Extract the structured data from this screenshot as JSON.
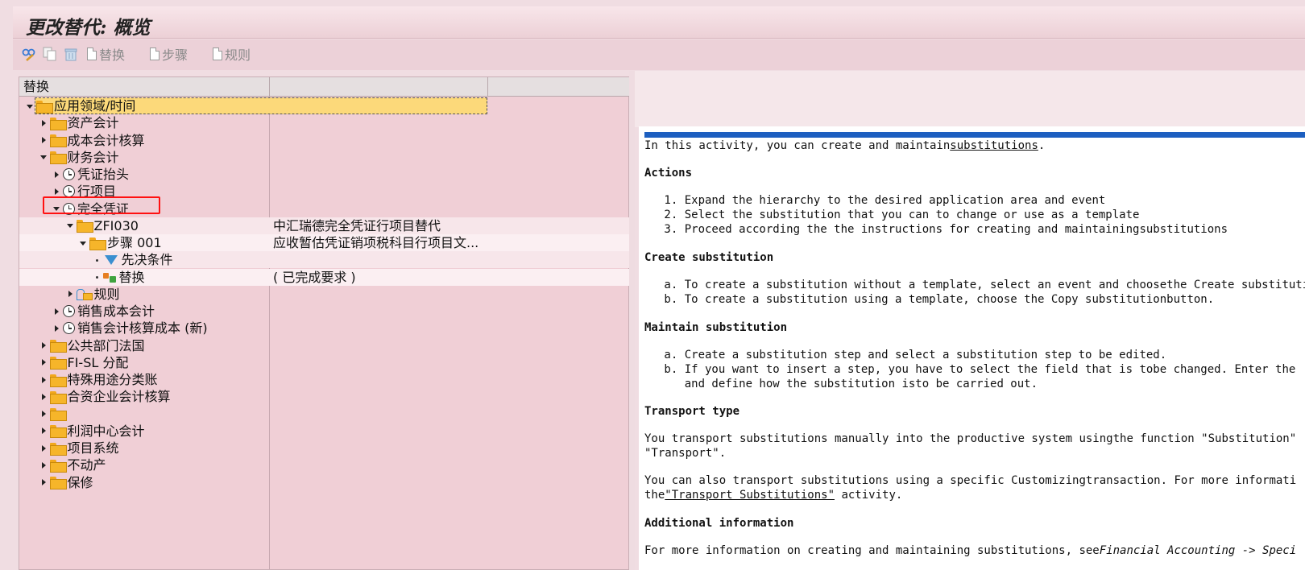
{
  "window": {
    "title": "更改替代: 概览"
  },
  "toolbar": {
    "icons": [
      "glasses-pencil-icon",
      "copy-icon",
      "trash-icon"
    ],
    "btn_replace": "替换",
    "btn_step": "步骤",
    "btn_rule": "规则"
  },
  "tree": {
    "header": "替换",
    "rows": [
      {
        "label": "应用领域/时间",
        "desc": "",
        "level": 0,
        "toggle": "open",
        "icon": "folder-open"
      },
      {
        "label": "资产会计",
        "desc": "",
        "level": 1,
        "toggle": "closed",
        "icon": "folder"
      },
      {
        "label": "成本会计核算",
        "desc": "",
        "level": 1,
        "toggle": "closed",
        "icon": "folder"
      },
      {
        "label": "财务会计",
        "desc": "",
        "level": 1,
        "toggle": "open",
        "icon": "folder-open"
      },
      {
        "label": "凭证抬头",
        "desc": "",
        "level": 2,
        "toggle": "closed",
        "icon": "clock"
      },
      {
        "label": "行项目",
        "desc": "",
        "level": 2,
        "toggle": "closed",
        "icon": "clock"
      },
      {
        "label": "完全凭证",
        "desc": "",
        "level": 2,
        "toggle": "open",
        "icon": "clock"
      },
      {
        "label": "ZFI030",
        "desc": "中汇瑞德完全凭证行项目替代",
        "level": 3,
        "toggle": "open",
        "icon": "folder-open"
      },
      {
        "label": "步骤 001",
        "desc": "应收暂估凭证销项税科目行项目文...",
        "level": 4,
        "toggle": "open",
        "icon": "folder-open"
      },
      {
        "label": "先决条件",
        "desc": "",
        "level": 5,
        "toggle": "dot",
        "icon": "filter"
      },
      {
        "label": "替换",
        "desc": "( 已完成要求 )",
        "level": 5,
        "toggle": "dot",
        "icon": "substitution"
      },
      {
        "label": "规则",
        "desc": "",
        "level": 3,
        "toggle": "closed",
        "icon": "rule"
      },
      {
        "label": "销售成本会计",
        "desc": "",
        "level": 2,
        "toggle": "closed",
        "icon": "clock"
      },
      {
        "label": "销售会计核算成本 (新)",
        "desc": "",
        "level": 2,
        "toggle": "closed",
        "icon": "clock"
      },
      {
        "label": "公共部门法国",
        "desc": "",
        "level": 1,
        "toggle": "closed",
        "icon": "folder"
      },
      {
        "label": "FI-SL 分配",
        "desc": "",
        "level": 1,
        "toggle": "closed",
        "icon": "folder"
      },
      {
        "label": "特殊用途分类账",
        "desc": "",
        "level": 1,
        "toggle": "closed",
        "icon": "folder"
      },
      {
        "label": "合资企业会计核算",
        "desc": "",
        "level": 1,
        "toggle": "closed",
        "icon": "folder"
      },
      {
        "label": "",
        "desc": "",
        "level": 1,
        "toggle": "closed",
        "icon": "folder"
      },
      {
        "label": "利润中心会计",
        "desc": "",
        "level": 1,
        "toggle": "closed",
        "icon": "folder"
      },
      {
        "label": "项目系统",
        "desc": "",
        "level": 1,
        "toggle": "closed",
        "icon": "folder"
      },
      {
        "label": "不动产",
        "desc": "",
        "level": 1,
        "toggle": "closed",
        "icon": "folder"
      },
      {
        "label": "保修",
        "desc": "",
        "level": 1,
        "toggle": "closed",
        "icon": "folder"
      }
    ]
  },
  "doc": {
    "intro_pre": "In this activity, you can create and maintain",
    "intro_link": "substitutions",
    "intro_post": ".",
    "actions_h": "Actions",
    "actions": [
      "Expand the hierarchy to the desired application area and event",
      "Select the substitution that you can to change or use as a template",
      "Proceed according the the instructions for creating and maintainingsubstitutions"
    ],
    "create_h": "Create substitution",
    "create": [
      "To create a substitution without a template, select an event and choosethe Create substitution",
      "To create a substitution using a template, choose the Copy substitutionbutton."
    ],
    "maintain_h": "Maintain substitution",
    "maintain": [
      "Create a substitution step and select a substitution step to be edited.",
      "If you want to insert a step, you have to select the field that is tobe changed. Enter the",
      "and define how the substitution isto be carried out."
    ],
    "transport_h": "Transport type",
    "transport_1": "You transport substitutions manually into the productive system usingthe function \"Substitution\"",
    "transport_2": "\"Transport\".",
    "transport_3": "You can also transport substitutions using a specific Customizingtransaction. For more informati",
    "transport_4_pre": "the",
    "transport_4_link": "\"Transport Substitutions\"",
    "transport_4_post": " activity.",
    "additional_h": "Additional information",
    "additional_pre": "For more information on creating and maintaining substitutions, see",
    "additional_it": "Financial Accounting -> Speci"
  }
}
